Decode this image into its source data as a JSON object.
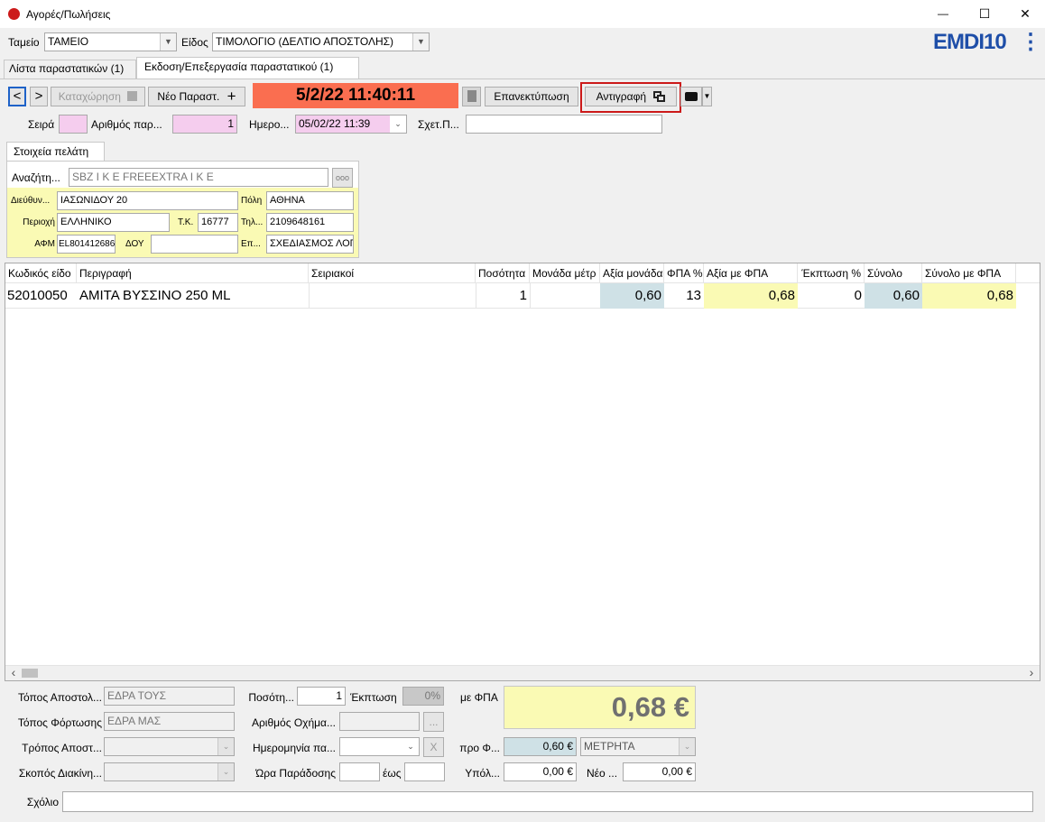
{
  "window": {
    "title": "Αγορές/Πωλήσεις",
    "minimize": "—",
    "maximize": "☐",
    "close": "✕"
  },
  "brand": {
    "logo": "EMDI10",
    "menu": "⋮"
  },
  "top": {
    "tameio_label": "Ταμείο",
    "tameio_value": "ΤΑΜΕΙΟ",
    "eidos_label": "Είδος",
    "eidos_value": "ΤΙΜΟΛΟΓΙΟ (ΔΕΛΤΙΟ ΑΠΟΣΤΟΛΗΣ)"
  },
  "tabs": [
    {
      "label": "Λίστα παραστατικών (1)"
    },
    {
      "label": "Εκδοση/Επεξεργασία παραστατικού (1)"
    }
  ],
  "toolbar": {
    "register": "Καταχώρηση",
    "new_doc": "Νέο Παραστ.",
    "datetime": "5/2/22 11:40:11",
    "reprint": "Επανεκτύπωση",
    "copy": "Αντιγραφή"
  },
  "doc": {
    "seira_label": "Σειρά",
    "seira_value": "",
    "arithmos_label": "Αριθμός παρ...",
    "arithmos_value": "1",
    "date_label": "Ημερο...",
    "date_value": "05/02/22 11:39",
    "sxet_label": "Σχετ.Π...",
    "sxet_value": ""
  },
  "customer": {
    "tab": "Στοιχεία πελάτη",
    "search_label": "Αναζήτη...",
    "search_value": "SBZ I K E  FREEEXTRA I K E",
    "search_btn": "ooo",
    "address_label": "Διεύθυν...",
    "address_value": "ΙΑΣΩΝΙΔΟΥ 20",
    "city_label": "Πόλη",
    "city_value": "ΑΘΗΝΑ",
    "area_label": "Περιοχή",
    "area_value": "ΕΛΛΗΝΙΚΟ",
    "tk_label": "Τ.Κ.",
    "tk_value": "16777",
    "phone_label": "Τηλ...",
    "phone_value": "2109648161",
    "afm_label": "ΑΦΜ",
    "afm_value": "EL801412686",
    "doy_label": "ΔΟΥ",
    "doy_value": "",
    "ep_label": "Επ...",
    "ep_value": "ΣΧΕΔΙΑΣΜΟΣ ΛΟΓ"
  },
  "grid": {
    "headers": [
      "Κωδικός είδο",
      "Περιγραφή",
      "Σειριακοί",
      "Ποσότητα",
      "Μονάδα μέτρ",
      "Αξία μονάδα",
      "ΦΠΑ %",
      "Αξία με ΦΠΑ",
      "Έκπτωση %",
      "Σύνολο",
      "Σύνολο με ΦΠΑ"
    ],
    "row": [
      "52010050",
      "ΑΜΙΤΑ ΒΥΣΣΙΝΟ 250 ML",
      "",
      "1",
      "",
      "0,60",
      "13",
      "0,68",
      "0",
      "0,60",
      "0,68"
    ],
    "scroll_left": "‹",
    "scroll_right": "›"
  },
  "footer": {
    "topos_apost_label": "Τόπος Αποστολ...",
    "topos_apost_value": "ΕΔΡΑ ΤΟΥΣ",
    "topos_fort_label": "Τόπος Φόρτωσης",
    "topos_fort_value": "ΕΔΡΑ ΜΑΣ",
    "tropos_label": "Τρόπος Αποστ...",
    "skopos_label": "Σκοπός Διακίνη...",
    "posotita_label": "Ποσότη...",
    "posotita_value": "1",
    "ekptosi_label": "Έκπτωση",
    "ekptosi_value": "0%",
    "oxima_label": "Αριθμός Οχήμα...",
    "oxima_btn": "...",
    "hmer_label": "Ημερομηνία πα...",
    "hmer_btn": "X",
    "ora_label": "Ώρα Παράδοσης",
    "eos_label": "έως",
    "me_fpa_label": "με ΦΠΑ",
    "total": "0,68 €",
    "pro_label": "προ Φ...",
    "pro_value": "0,60 €",
    "payment": "ΜΕΤΡΗΤΑ",
    "ypol_label": "Υπόλ...",
    "ypol_value": "0,00 €",
    "neo_label": "Νέο ...",
    "neo_value": "0,00 €",
    "sxolio_label": "Σχόλιο",
    "sxolio_value": ""
  },
  "colors": {
    "accent_red": "#cc1a1a",
    "datetime_bg": "#fa6e50",
    "pink": "#f5cdee",
    "yellow": "#fafab4",
    "blue": "#cfe1e6",
    "logo_blue": "#1e4ea8"
  }
}
